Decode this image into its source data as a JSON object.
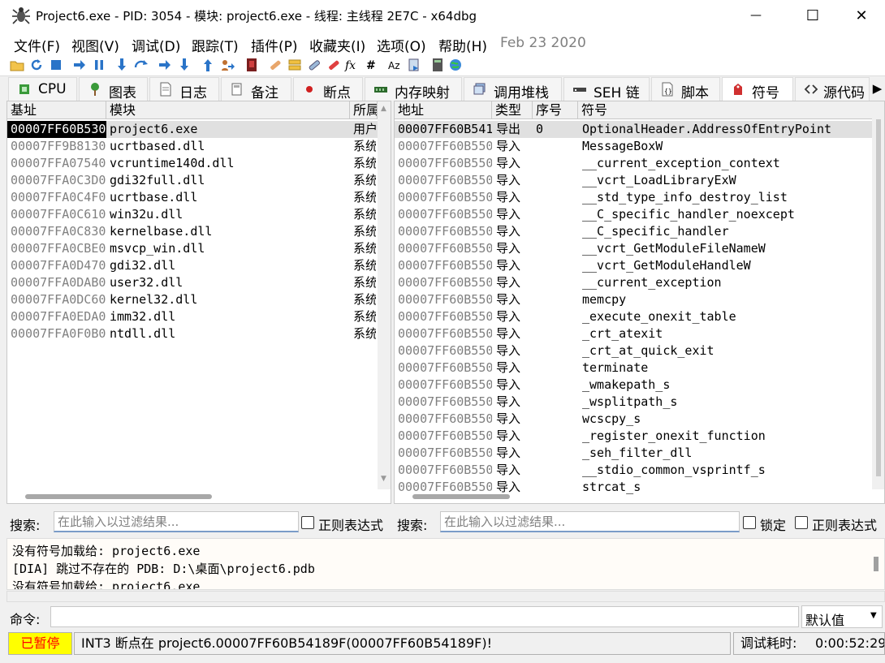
{
  "window": {
    "title": "Project6.exe - PID: 3054 - 模块: project6.exe - 线程: 主线程 2E7C - x64dbg",
    "minimize_glyph": "—",
    "maximize_glyph": "☐",
    "close_glyph": "✕"
  },
  "menu": {
    "items": [
      "文件(F)",
      "视图(V)",
      "调试(D)",
      "跟踪(T)",
      "插件(P)",
      "收藏夹(I)",
      "选项(O)",
      "帮助(H)"
    ],
    "date": "Feb 23 2020"
  },
  "toolbar": {
    "icons": [
      "open-icon",
      "restart-icon",
      "stop-icon",
      "run-icon",
      "pause-icon",
      "step-into-icon",
      "step-over-icon",
      "trace-into-icon",
      "trace-over-icon",
      "execute-till-return-icon",
      "run-to-user-code-icon",
      "scylla-icon",
      "patch-icon",
      "comment-icon",
      "label-icon",
      "bookmark-icon",
      "function-icon",
      "hash-icon",
      "font-icon",
      "strings-icon",
      "calculator-icon",
      "globe-icon"
    ]
  },
  "tabs": [
    {
      "label": "CPU",
      "icon": "cpu-icon"
    },
    {
      "label": "图表",
      "icon": "graph-icon"
    },
    {
      "label": "日志",
      "icon": "log-icon"
    },
    {
      "label": "备注",
      "icon": "notes-icon"
    },
    {
      "label": "断点",
      "icon": "breakpoint-icon"
    },
    {
      "label": "内存映射",
      "icon": "memory-map-icon"
    },
    {
      "label": "调用堆栈",
      "icon": "call-stack-icon"
    },
    {
      "label": "SEH 链",
      "icon": "seh-icon"
    },
    {
      "label": "脚本",
      "icon": "script-icon"
    },
    {
      "label": "符号",
      "icon": "symbol-icon"
    },
    {
      "label": "源代码",
      "icon": "source-icon"
    }
  ],
  "tab_more_glyph": "▶",
  "modules": {
    "headers": [
      "基址",
      "模块",
      "所属"
    ],
    "rows": [
      {
        "base": "00007FF60B530",
        "name": "project6.exe",
        "party": "用户"
      },
      {
        "base": "00007FF9B8130",
        "name": "ucrtbased.dll",
        "party": "系统"
      },
      {
        "base": "00007FFA07540",
        "name": "vcruntime140d.dll",
        "party": "系统"
      },
      {
        "base": "00007FFA0C3D0",
        "name": "gdi32full.dll",
        "party": "系统"
      },
      {
        "base": "00007FFA0C4F0",
        "name": "ucrtbase.dll",
        "party": "系统"
      },
      {
        "base": "00007FFA0C610",
        "name": "win32u.dll",
        "party": "系统"
      },
      {
        "base": "00007FFA0C830",
        "name": "kernelbase.dll",
        "party": "系统"
      },
      {
        "base": "00007FFA0CBE0",
        "name": "msvcp_win.dll",
        "party": "系统"
      },
      {
        "base": "00007FFA0D470",
        "name": "gdi32.dll",
        "party": "系统"
      },
      {
        "base": "00007FFA0DAB0",
        "name": "user32.dll",
        "party": "系统"
      },
      {
        "base": "00007FFA0DC60",
        "name": "kernel32.dll",
        "party": "系统"
      },
      {
        "base": "00007FFA0EDA0",
        "name": "imm32.dll",
        "party": "系统"
      },
      {
        "base": "00007FFA0F0B0",
        "name": "ntdll.dll",
        "party": "系统"
      }
    ]
  },
  "symbols": {
    "headers": [
      "地址",
      "类型",
      "序号",
      "符号"
    ],
    "rows": [
      {
        "addr": "00007FF60B541",
        "type": "导出",
        "ord": "0",
        "sym": "OptionalHeader.AddressOfEntryPoint"
      },
      {
        "addr": "00007FF60B550",
        "type": "导入",
        "ord": "",
        "sym": "MessageBoxW"
      },
      {
        "addr": "00007FF60B550",
        "type": "导入",
        "ord": "",
        "sym": "__current_exception_context"
      },
      {
        "addr": "00007FF60B550",
        "type": "导入",
        "ord": "",
        "sym": "__vcrt_LoadLibraryExW"
      },
      {
        "addr": "00007FF60B550",
        "type": "导入",
        "ord": "",
        "sym": "__std_type_info_destroy_list"
      },
      {
        "addr": "00007FF60B550",
        "type": "导入",
        "ord": "",
        "sym": "__C_specific_handler_noexcept"
      },
      {
        "addr": "00007FF60B550",
        "type": "导入",
        "ord": "",
        "sym": "__C_specific_handler"
      },
      {
        "addr": "00007FF60B550",
        "type": "导入",
        "ord": "",
        "sym": "__vcrt_GetModuleFileNameW"
      },
      {
        "addr": "00007FF60B550",
        "type": "导入",
        "ord": "",
        "sym": "__vcrt_GetModuleHandleW"
      },
      {
        "addr": "00007FF60B550",
        "type": "导入",
        "ord": "",
        "sym": "__current_exception"
      },
      {
        "addr": "00007FF60B550",
        "type": "导入",
        "ord": "",
        "sym": "memcpy"
      },
      {
        "addr": "00007FF60B550",
        "type": "导入",
        "ord": "",
        "sym": "_execute_onexit_table"
      },
      {
        "addr": "00007FF60B550",
        "type": "导入",
        "ord": "",
        "sym": "_crt_atexit"
      },
      {
        "addr": "00007FF60B550",
        "type": "导入",
        "ord": "",
        "sym": "_crt_at_quick_exit"
      },
      {
        "addr": "00007FF60B550",
        "type": "导入",
        "ord": "",
        "sym": "terminate"
      },
      {
        "addr": "00007FF60B550",
        "type": "导入",
        "ord": "",
        "sym": "_wmakepath_s"
      },
      {
        "addr": "00007FF60B550",
        "type": "导入",
        "ord": "",
        "sym": "_wsplitpath_s"
      },
      {
        "addr": "00007FF60B550",
        "type": "导入",
        "ord": "",
        "sym": "wcscpy_s"
      },
      {
        "addr": "00007FF60B550",
        "type": "导入",
        "ord": "",
        "sym": "_register_onexit_function"
      },
      {
        "addr": "00007FF60B550",
        "type": "导入",
        "ord": "",
        "sym": "_seh_filter_dll"
      },
      {
        "addr": "00007FF60B550",
        "type": "导入",
        "ord": "",
        "sym": "__stdio_common_vsprintf_s"
      },
      {
        "addr": "00007FF60B550",
        "type": "导入",
        "ord": "",
        "sym": "strcat_s"
      }
    ]
  },
  "filters": {
    "left_label": "搜索:",
    "left_placeholder": "在此输入以过滤结果...",
    "left_regex": "正则表达式",
    "right_label": "搜索:",
    "right_placeholder": "在此输入以过滤结果...",
    "lock": "锁定",
    "right_regex": "正则表达式"
  },
  "log": {
    "lines": [
      "没有符号加载给: project6.exe",
      "[DIA] 跳过不存在的 PDB: D:\\桌面\\project6.pdb",
      "没有符号加载给: project6.exe"
    ]
  },
  "command": {
    "label": "命令:",
    "value": "",
    "dropdown": "默认值"
  },
  "status": {
    "state": "已暂停",
    "message": "INT3 断点在 project6.00007FF60B54189F(00007FF60B54189F)!",
    "timer_label": "调试耗时:",
    "timer": "0:00:52:29"
  },
  "colors": {
    "paused_bg": "#ffff00",
    "paused_fg": "#ff0000",
    "selected_row": "#e0e0e0",
    "gray_text": "#808080"
  }
}
